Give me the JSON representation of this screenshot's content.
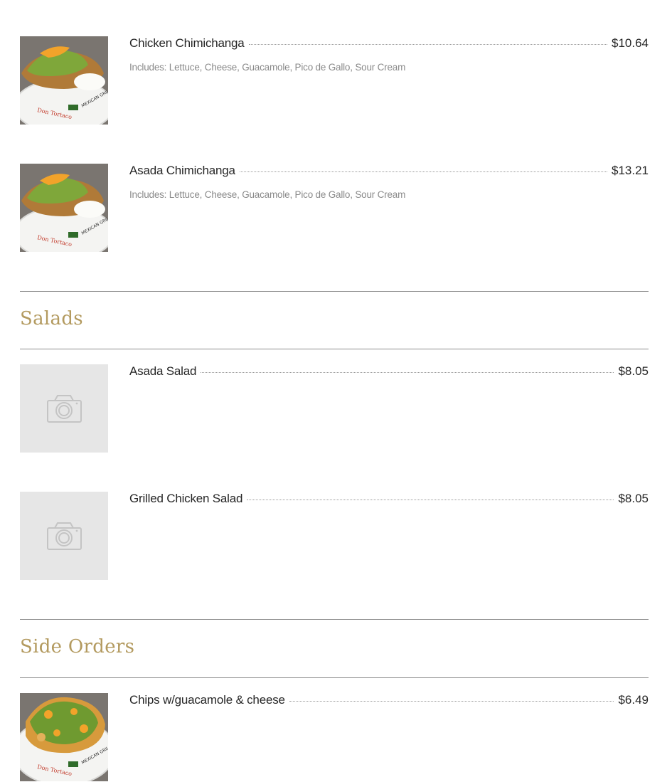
{
  "items_top": [
    {
      "name": "Chicken Chimichanga",
      "price": "$10.64",
      "desc": "Includes: Lettuce, Cheese, Guacamole, Pico de Gallo, Sour Cream",
      "image": "chimichanga-photo"
    },
    {
      "name": "Asada Chimichanga",
      "price": "$13.21",
      "desc": "Includes: Lettuce, Cheese, Guacamole, Pico de Gallo, Sour Cream",
      "image": "chimichanga-photo"
    }
  ],
  "sections": [
    {
      "title": "Salads",
      "items": [
        {
          "name": "Asada Salad",
          "price": "$8.05",
          "image": "camera-placeholder"
        },
        {
          "name": "Grilled Chicken Salad",
          "price": "$8.05",
          "image": "camera-placeholder"
        }
      ]
    },
    {
      "title": "Side Orders",
      "items": [
        {
          "name": "Chips w/guacamole & cheese",
          "price": "$6.49",
          "image": "nachos-photo"
        }
      ]
    }
  ],
  "colors": {
    "section_title": "#b39a5f",
    "rule": "#8c8c8c",
    "placeholder_bg": "#e6e6e6"
  }
}
